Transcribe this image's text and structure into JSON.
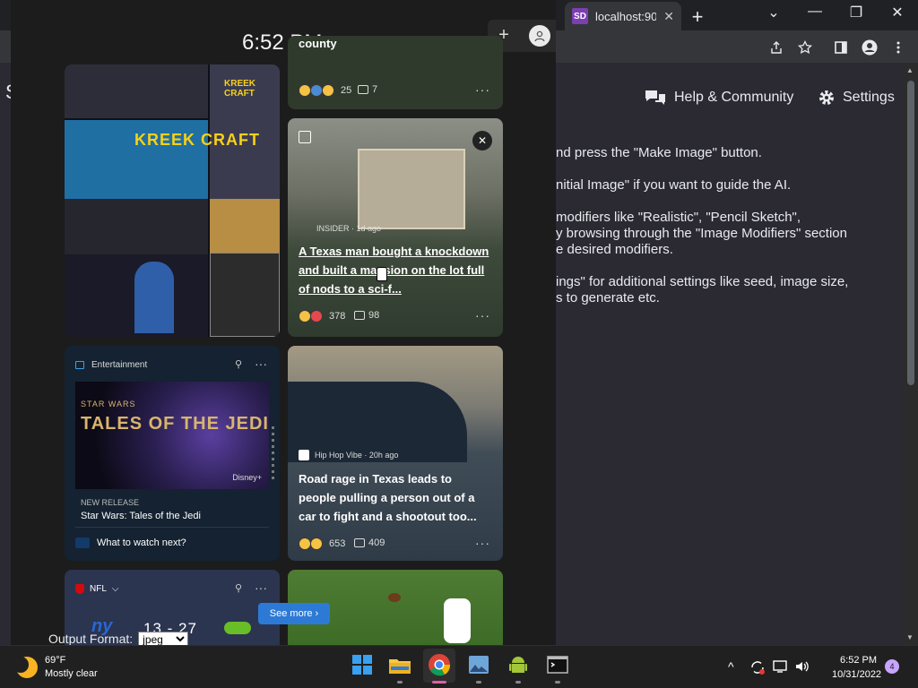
{
  "browser": {
    "tab": {
      "favicon": "SD",
      "title": "localhost:90",
      "close": "✕"
    },
    "new_tab": "+",
    "window_controls": [
      "⌄",
      "—",
      "❐",
      "✕"
    ],
    "toolbar_icons": [
      "share-icon",
      "star-icon",
      "sidebar-icon",
      "profile-icon",
      "menu-icon"
    ]
  },
  "app": {
    "left_cut_letter": "S",
    "nav": {
      "help": "Help & Community",
      "settings": "Settings"
    },
    "help_lines": [
      "nd press the \"Make Image\" button.",
      "nitial Image\" if you want to guide the AI.",
      " modifiers like \"Realistic\", \"Pencil Sketch\",",
      "y browsing through the \"Image Modifiers\" section",
      "e desired modifiers.",
      "ings\" for additional settings like seed, image size,",
      "s to generate etc."
    ],
    "output_format": {
      "label": "Output Format:",
      "value": "jpeg"
    }
  },
  "widgets": {
    "clock": "6:52 PM",
    "plus": "+",
    "collage": {
      "brand": "KREEK CRAFT",
      "brand_small": "KREEK CRAFT"
    },
    "top_card": {
      "tail": "county",
      "reactions": "25",
      "comments": "7",
      "more": "···"
    },
    "mansion_card": {
      "source": "INSIDER · 1d ago",
      "headline": "A Texas man bought a knockdown and built a mansion on the lot full of nods to a sci-f...",
      "reactions": "378",
      "comments": "98",
      "more": "···",
      "close": "✕"
    },
    "entertainment_card": {
      "category": "Entertainment",
      "pin": "⚲",
      "more": "···",
      "img_sub": "STAR WARS",
      "img_title": "TALES OF THE JEDI",
      "img_brand": "Disney+",
      "tag": "NEW RELEASE",
      "title": "Star Wars: Tales of the Jedi",
      "footer": "What to watch next?"
    },
    "road_card": {
      "source": "Hip Hop Vibe · 20h ago",
      "headline": "Road rage in Texas leads to people pulling a person out of a car to fight and a shootout too...",
      "reactions": "653",
      "comments": "409",
      "more": "···"
    },
    "nfl_card": {
      "label": "NFL",
      "chevron": "⌵",
      "pin": "⚲",
      "more": "···",
      "team1": "ny",
      "score": "13 - 27"
    },
    "see_more": "See more ›"
  },
  "taskbar": {
    "weather": {
      "temp": "69°F",
      "condition": "Mostly clear"
    },
    "apps": [
      "windows-start-icon",
      "file-explorer-icon",
      "chrome-icon",
      "photos-icon",
      "android-icon",
      "terminal-icon"
    ],
    "tray": {
      "chevron": "^",
      "time": "6:52 PM",
      "date": "10/31/2022",
      "badge": "4"
    }
  }
}
